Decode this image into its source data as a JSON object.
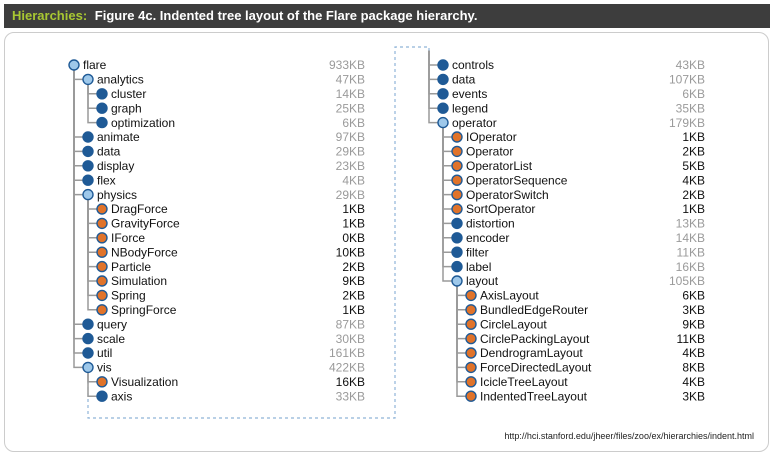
{
  "header": {
    "label": "Hierarchies:",
    "title": "Figure 4c. Indented tree layout of the Flare package hierarchy."
  },
  "colors": {
    "leaf": "#e0732a",
    "collapsed": "#1f5a96",
    "expanded": "#9ec8ea",
    "size_leaf": "#111111",
    "size_internal": "#9a9a9a",
    "link": "#9a9a9a",
    "border": "#8fb4d8"
  },
  "columns": [
    {
      "id": "left",
      "nodes": [
        {
          "name": "flare",
          "size": "933KB",
          "depth": 0,
          "kind": "expanded"
        },
        {
          "name": "analytics",
          "size": "47KB",
          "depth": 1,
          "kind": "expanded"
        },
        {
          "name": "cluster",
          "size": "14KB",
          "depth": 2,
          "kind": "collapsed"
        },
        {
          "name": "graph",
          "size": "25KB",
          "depth": 2,
          "kind": "collapsed"
        },
        {
          "name": "optimization",
          "size": "6KB",
          "depth": 2,
          "kind": "collapsed"
        },
        {
          "name": "animate",
          "size": "97KB",
          "depth": 1,
          "kind": "collapsed"
        },
        {
          "name": "data",
          "size": "29KB",
          "depth": 1,
          "kind": "collapsed"
        },
        {
          "name": "display",
          "size": "23KB",
          "depth": 1,
          "kind": "collapsed"
        },
        {
          "name": "flex",
          "size": "4KB",
          "depth": 1,
          "kind": "collapsed"
        },
        {
          "name": "physics",
          "size": "29KB",
          "depth": 1,
          "kind": "expanded"
        },
        {
          "name": "DragForce",
          "size": "1KB",
          "depth": 2,
          "kind": "leaf"
        },
        {
          "name": "GravityForce",
          "size": "1KB",
          "depth": 2,
          "kind": "leaf"
        },
        {
          "name": "IForce",
          "size": "0KB",
          "depth": 2,
          "kind": "leaf"
        },
        {
          "name": "NBodyForce",
          "size": "10KB",
          "depth": 2,
          "kind": "leaf"
        },
        {
          "name": "Particle",
          "size": "2KB",
          "depth": 2,
          "kind": "leaf"
        },
        {
          "name": "Simulation",
          "size": "9KB",
          "depth": 2,
          "kind": "leaf"
        },
        {
          "name": "Spring",
          "size": "2KB",
          "depth": 2,
          "kind": "leaf"
        },
        {
          "name": "SpringForce",
          "size": "1KB",
          "depth": 2,
          "kind": "leaf"
        },
        {
          "name": "query",
          "size": "87KB",
          "depth": 1,
          "kind": "collapsed"
        },
        {
          "name": "scale",
          "size": "30KB",
          "depth": 1,
          "kind": "collapsed"
        },
        {
          "name": "util",
          "size": "161KB",
          "depth": 1,
          "kind": "collapsed"
        },
        {
          "name": "vis",
          "size": "422KB",
          "depth": 1,
          "kind": "expanded"
        },
        {
          "name": "Visualization",
          "size": "16KB",
          "depth": 2,
          "kind": "leaf"
        },
        {
          "name": "axis",
          "size": "33KB",
          "depth": 2,
          "kind": "collapsed"
        }
      ]
    },
    {
      "id": "right",
      "nodes": [
        {
          "name": "controls",
          "size": "43KB",
          "depth": 2,
          "kind": "collapsed"
        },
        {
          "name": "data",
          "size": "107KB",
          "depth": 2,
          "kind": "collapsed"
        },
        {
          "name": "events",
          "size": "6KB",
          "depth": 2,
          "kind": "collapsed"
        },
        {
          "name": "legend",
          "size": "35KB",
          "depth": 2,
          "kind": "collapsed"
        },
        {
          "name": "operator",
          "size": "179KB",
          "depth": 2,
          "kind": "expanded"
        },
        {
          "name": "IOperator",
          "size": "1KB",
          "depth": 3,
          "kind": "leaf"
        },
        {
          "name": "Operator",
          "size": "2KB",
          "depth": 3,
          "kind": "leaf"
        },
        {
          "name": "OperatorList",
          "size": "5KB",
          "depth": 3,
          "kind": "leaf"
        },
        {
          "name": "OperatorSequence",
          "size": "4KB",
          "depth": 3,
          "kind": "leaf"
        },
        {
          "name": "OperatorSwitch",
          "size": "2KB",
          "depth": 3,
          "kind": "leaf"
        },
        {
          "name": "SortOperator",
          "size": "1KB",
          "depth": 3,
          "kind": "leaf"
        },
        {
          "name": "distortion",
          "size": "13KB",
          "depth": 3,
          "kind": "collapsed"
        },
        {
          "name": "encoder",
          "size": "14KB",
          "depth": 3,
          "kind": "collapsed"
        },
        {
          "name": "filter",
          "size": "11KB",
          "depth": 3,
          "kind": "collapsed"
        },
        {
          "name": "label",
          "size": "16KB",
          "depth": 3,
          "kind": "collapsed"
        },
        {
          "name": "layout",
          "size": "105KB",
          "depth": 3,
          "kind": "expanded"
        },
        {
          "name": "AxisLayout",
          "size": "6KB",
          "depth": 4,
          "kind": "leaf"
        },
        {
          "name": "BundledEdgeRouter",
          "size": "3KB",
          "depth": 4,
          "kind": "leaf"
        },
        {
          "name": "CircleLayout",
          "size": "9KB",
          "depth": 4,
          "kind": "leaf"
        },
        {
          "name": "CirclePackingLayout",
          "size": "11KB",
          "depth": 4,
          "kind": "leaf"
        },
        {
          "name": "DendrogramLayout",
          "size": "4KB",
          "depth": 4,
          "kind": "leaf"
        },
        {
          "name": "ForceDirectedLayout",
          "size": "8KB",
          "depth": 4,
          "kind": "leaf"
        },
        {
          "name": "IcicleTreeLayout",
          "size": "4KB",
          "depth": 4,
          "kind": "leaf"
        },
        {
          "name": "IndentedTreeLayout",
          "size": "3KB",
          "depth": 4,
          "kind": "leaf"
        }
      ]
    }
  ],
  "footer": {
    "url": "http://hci.stanford.edu/jheer/files/zoo/ex/hierarchies/indent.html"
  }
}
